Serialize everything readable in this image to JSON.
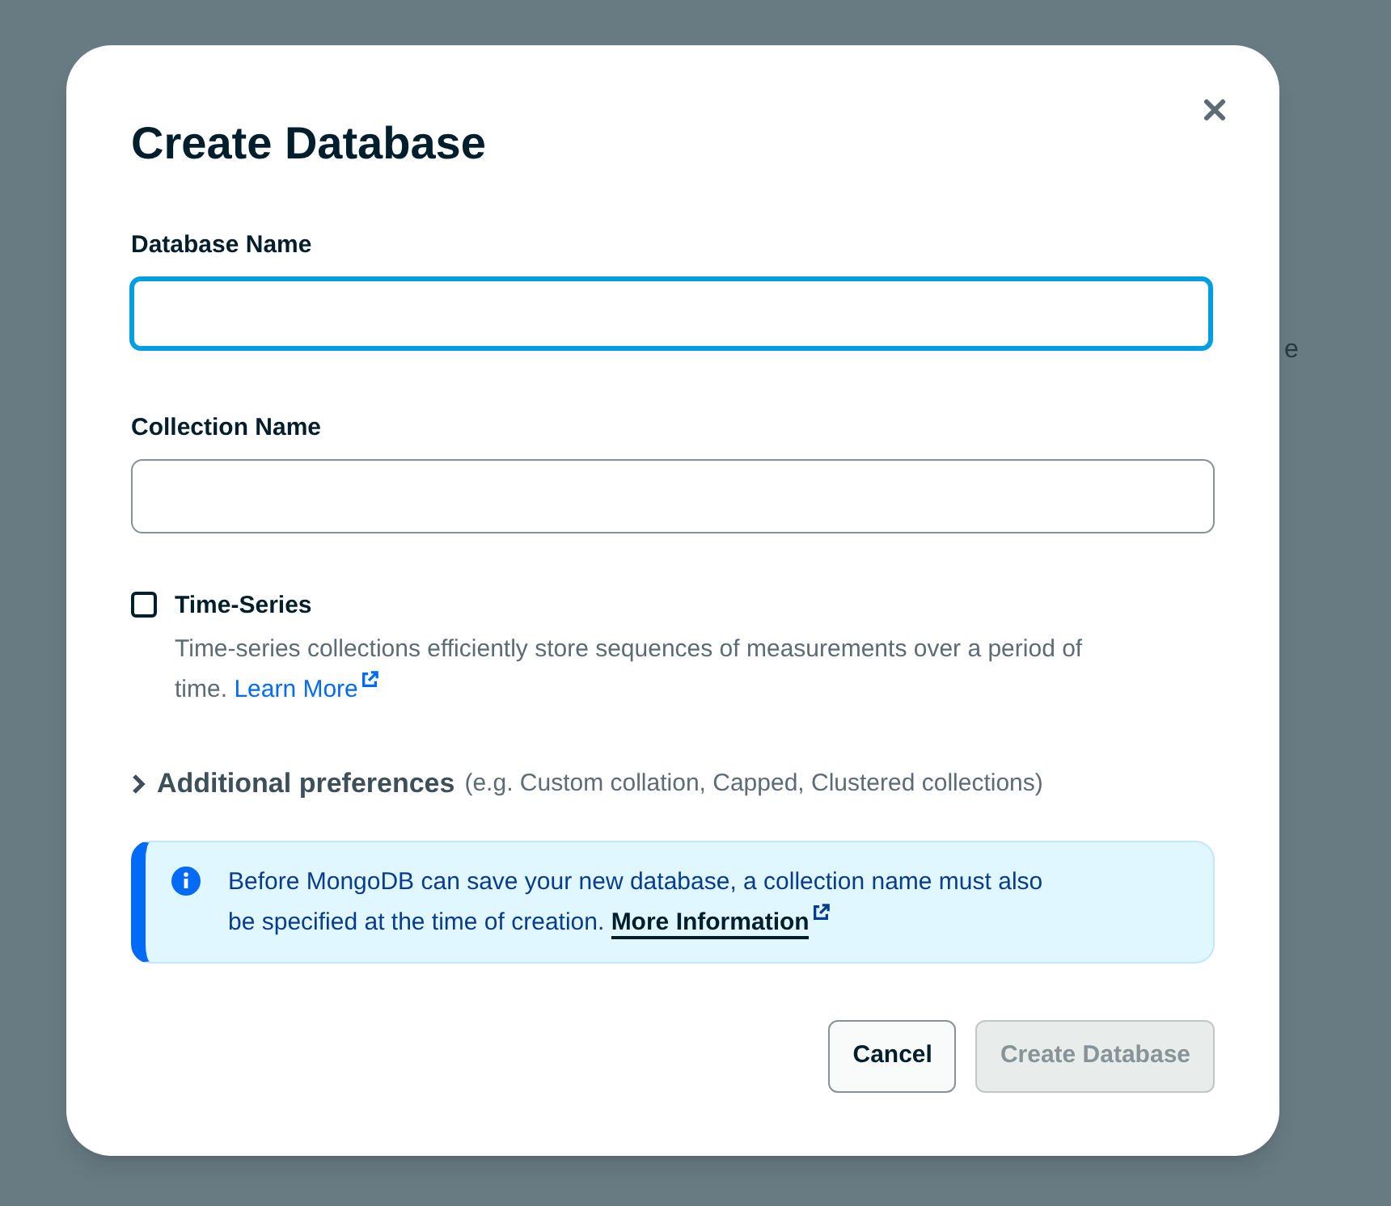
{
  "background_text": "e",
  "dialog": {
    "title": "Create Database"
  },
  "fields": [
    {
      "label": "Database Name",
      "focused": true
    },
    {
      "label": "Collection Name",
      "focused": false
    }
  ],
  "time_series": {
    "label": "Time-Series",
    "checked": false,
    "description": "Time-series collections efficiently store sequences of measurements over a period of time.",
    "link": "Learn More"
  },
  "additional_preferences": {
    "label": "Additional preferences",
    "hint": "(e.g. Custom collation, Capped, Clustered collections)",
    "expanded": false
  },
  "info": {
    "text": "Before MongoDB can save your new database, a collection name must also be specified at the time of creation.",
    "link": "More Information"
  },
  "buttons": [
    {
      "label": "Cancel",
      "disabled": false
    },
    {
      "label": "Create Database",
      "disabled": true
    }
  ]
}
